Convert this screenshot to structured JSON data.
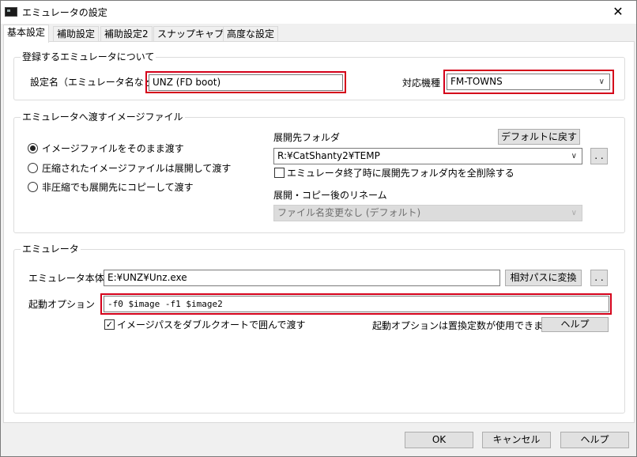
{
  "window": {
    "title": "エミュレータの設定",
    "close_glyph": "✕"
  },
  "tabs": [
    "基本設定",
    "補助設定",
    "補助設定2",
    "スナップキャプチャ",
    "高度な設定"
  ],
  "group_emulator_info": {
    "title": "登録するエミュレータについて",
    "name_label": "設定名（エミュレータ名など）",
    "name_value": "UNZ (FD boot)",
    "machine_label": "対応機種",
    "machine_value": "FM-TOWNS"
  },
  "group_image": {
    "title": "エミュレータへ渡すイメージファイル",
    "radio_options": [
      "イメージファイルをそのまま渡す",
      "圧縮されたイメージファイルは展開して渡す",
      "非圧縮でも展開先にコピーして渡す"
    ],
    "selected_option": 0,
    "extract_folder_label": "展開先フォルダ",
    "default_button": "デフォルトに戻す",
    "extract_folder_value": "R:¥CatShanty2¥TEMP",
    "browse_button": ". .",
    "delete_on_exit_label": "エミュレータ終了時に展開先フォルダ内を全削除する",
    "delete_on_exit_checked": false,
    "rename_label": "展開・コピー後のリネーム",
    "rename_value": "ファイル名変更なし (デフォルト)"
  },
  "group_emulator": {
    "title": "エミュレータ",
    "exe_label": "エミュレータ本体",
    "exe_value": "E:¥UNZ¥Unz.exe",
    "relative_button": "相対パスに変換",
    "browse_button": ". .",
    "options_label": "起動オプション",
    "options_value": "-f0 $image -f1 $image2",
    "quote_label": "イメージパスをダブルクオートで囲んで渡す",
    "quote_checked": true,
    "placeholder_note": "起動オプションは置換定数が使用できます。",
    "help_button": "ヘルプ"
  },
  "footer": {
    "ok": "OK",
    "cancel": "キャンセル",
    "help": "ヘルプ"
  },
  "colors": {
    "highlight_frame": "#d4001a"
  }
}
